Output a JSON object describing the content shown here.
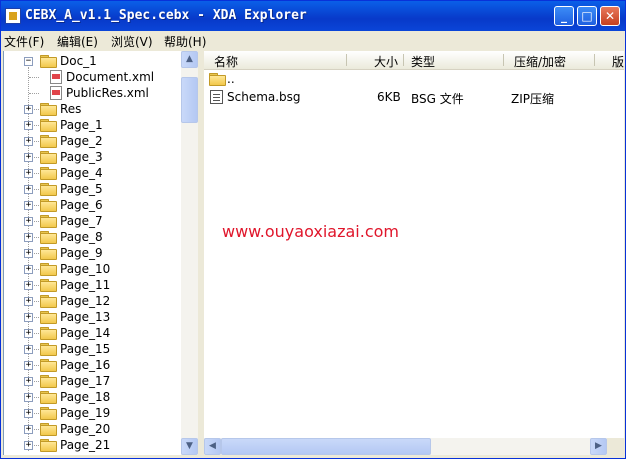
{
  "window": {
    "title": "CEBX_A_v1.1_Spec.cebx - XDA Explorer"
  },
  "title_buttons": {
    "minimize": "_",
    "maximize": "□",
    "close": "✕"
  },
  "menu": [
    "文件(F)",
    "编辑(E)",
    "浏览(V)",
    "帮助(H)"
  ],
  "tree": {
    "root": "Doc_1",
    "files": [
      "Document.xml",
      "PublicRes.xml"
    ],
    "folders": [
      "Res",
      "Page_1",
      "Page_2",
      "Page_3",
      "Page_4",
      "Page_5",
      "Page_6",
      "Page_7",
      "Page_8",
      "Page_9",
      "Page_10",
      "Page_11",
      "Page_12",
      "Page_13",
      "Page_14",
      "Page_15",
      "Page_16",
      "Page_17",
      "Page_18",
      "Page_19",
      "Page_20",
      "Page_21"
    ]
  },
  "list": {
    "columns": [
      "名称",
      "大小",
      "类型",
      "压缩/加密",
      "版"
    ],
    "rows": [
      {
        "name": "..",
        "size": "",
        "type": "",
        "compress": "",
        "icon": "folder-icon"
      },
      {
        "name": "Schema.bsg",
        "size": "6KB",
        "type": "BSG 文件",
        "compress": "ZIP压缩",
        "icon": "bsg-file-icon"
      }
    ]
  },
  "watermark": "www.ouyaoxiazai.com",
  "scroll_arrows": {
    "up": "▲",
    "down": "▼",
    "left": "◀",
    "right": "▶"
  }
}
